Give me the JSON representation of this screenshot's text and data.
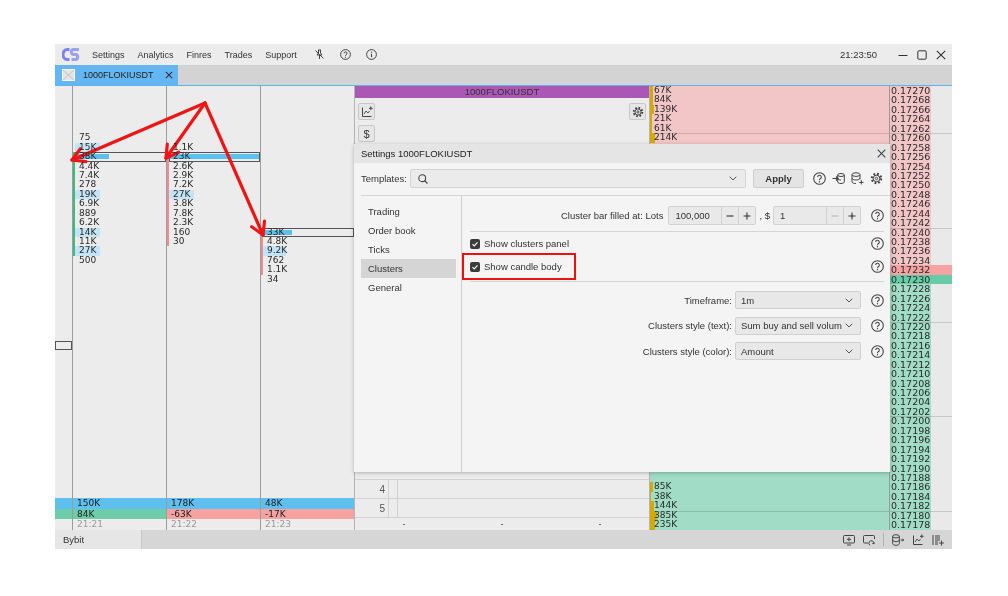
{
  "titlebar": {
    "menu": [
      "Settings",
      "Analytics",
      "Finres",
      "Trades",
      "Support"
    ],
    "clock": "21:23:50"
  },
  "tabs": [
    {
      "label": "1000FLOKIUSDT",
      "selected": true
    }
  ],
  "clusters": {
    "edge_column": {
      "delta": {
        "color": "#6dcca9"
      }
    },
    "columns": [
      {
        "candle": {
          "color": "#3dba80"
        },
        "volume": "150K",
        "delta": {
          "text": "84K",
          "color": "#6dcca9"
        },
        "time": "21:21",
        "cells_above": [
          {
            "text": "75",
            "kind": "plain"
          },
          {
            "text": "15K",
            "kind": "shaded",
            "level": 0.27
          }
        ],
        "body_cells": [
          {
            "text": "38K",
            "kind": "peak",
            "level": 0.37
          },
          {
            "text": "4.4K",
            "kind": "plain"
          },
          {
            "text": "7.4K",
            "kind": "plain"
          },
          {
            "text": "278",
            "kind": "plain"
          },
          {
            "text": "19K",
            "kind": "shaded",
            "level": 0.27
          },
          {
            "text": "6.9K",
            "kind": "plain"
          },
          {
            "text": "889",
            "kind": "plain"
          },
          {
            "text": "6.2K",
            "kind": "plain"
          },
          {
            "text": "14K",
            "kind": "shaded",
            "level": 0.27
          },
          {
            "text": "11K",
            "kind": "plain"
          },
          {
            "text": "27K",
            "kind": "shaded",
            "level": 0.27
          }
        ],
        "cells_below": [
          {
            "text": "500",
            "kind": "plain"
          }
        ]
      },
      {
        "candle": {
          "color": "#f28c8c"
        },
        "volume": "178K",
        "delta": {
          "text": "-63K",
          "color": "#f7a1a1"
        },
        "time": "21:22",
        "cells_above": [
          {
            "text": "1.1K",
            "kind": "plain"
          }
        ],
        "body_cells": [
          {
            "text": "23K",
            "kind": "peak",
            "level": 1
          },
          {
            "text": "2.6K",
            "kind": "plain"
          },
          {
            "text": "2.9K",
            "kind": "plain"
          },
          {
            "text": "7.2K",
            "kind": "plain"
          },
          {
            "text": "27K",
            "kind": "shaded",
            "level": 0.27
          },
          {
            "text": "3.8K",
            "kind": "plain"
          },
          {
            "text": "7.8K",
            "kind": "plain"
          },
          {
            "text": "2.3K",
            "kind": "plain"
          },
          {
            "text": "160",
            "kind": "plain"
          },
          {
            "text": "30",
            "kind": "plain"
          }
        ]
      },
      {
        "candle": {
          "color": "#f28c8c"
        },
        "volume": "48K",
        "delta": {
          "text": "-17K",
          "color": "#f7a1a1"
        },
        "time": "21:23",
        "body_cells": [
          {
            "text": "33K",
            "kind": "peak",
            "level": 0.31
          },
          {
            "text": "4.8K",
            "kind": "plain"
          },
          {
            "text": "9.2K",
            "kind": "shaded",
            "level": 0.25
          },
          {
            "text": "762",
            "kind": "plain"
          },
          {
            "text": "1.1K",
            "kind": "plain"
          }
        ],
        "cells_below": [
          {
            "text": "34",
            "kind": "plain"
          }
        ]
      }
    ]
  },
  "order_book": {
    "title": "1000FLOKIUSDT",
    "currency_button": "$",
    "row_numbers": [
      "4",
      "5"
    ],
    "footer": [
      "-",
      "-",
      "-"
    ],
    "asks": [
      {
        "text": "67K",
        "level": 0.012
      },
      {
        "text": "84K",
        "level": 0.012
      },
      {
        "text": "139K",
        "level": 0.018
      },
      {
        "text": "21K",
        "level": 0.008
      },
      {
        "text": "61K",
        "level": 0.01
      },
      {
        "text": "214K",
        "level": 0.022
      }
    ],
    "bids": [
      {
        "text": "85K",
        "level": 0.012
      },
      {
        "text": "38K",
        "level": 0.006
      },
      {
        "text": "144K",
        "level": 0.015
      },
      {
        "text": "385K",
        "level": 0.028
      },
      {
        "text": "235K",
        "level": 0.02
      }
    ],
    "prices": [
      {
        "text": "0.17270",
        "kind": "ask",
        "best": false
      },
      {
        "text": "0.17268",
        "kind": "ask",
        "best": false
      },
      {
        "text": "0.17266",
        "kind": "ask",
        "best": false
      },
      {
        "text": "0.17264",
        "kind": "ask",
        "best": false
      },
      {
        "text": "0.17262",
        "kind": "ask",
        "best": false
      },
      {
        "text": "0.17260",
        "kind": "ask",
        "best": false
      },
      {
        "text": "0.17258",
        "kind": "ask",
        "best": false
      },
      {
        "text": "0.17256",
        "kind": "ask",
        "best": false
      },
      {
        "text": "0.17254",
        "kind": "ask",
        "best": false
      },
      {
        "text": "0.17252",
        "kind": "ask",
        "best": false
      },
      {
        "text": "0.17250",
        "kind": "ask",
        "best": false
      },
      {
        "text": "0.17248",
        "kind": "ask",
        "best": false
      },
      {
        "text": "0.17246",
        "kind": "ask",
        "best": false
      },
      {
        "text": "0.17244",
        "kind": "ask",
        "best": false
      },
      {
        "text": "0.17242",
        "kind": "ask",
        "best": false
      },
      {
        "text": "0.17240",
        "kind": "ask",
        "best": false
      },
      {
        "text": "0.17238",
        "kind": "ask",
        "best": false
      },
      {
        "text": "0.17236",
        "kind": "ask",
        "best": false
      },
      {
        "text": "0.17234",
        "kind": "ask",
        "best": false
      },
      {
        "text": "0.17232",
        "kind": "ask",
        "best": true
      },
      {
        "text": "0.17230",
        "kind": "bid",
        "best": true
      },
      {
        "text": "0.17228",
        "kind": "bid",
        "best": false
      },
      {
        "text": "0.17226",
        "kind": "bid",
        "best": false
      },
      {
        "text": "0.17224",
        "kind": "bid",
        "best": false
      },
      {
        "text": "0.17222",
        "kind": "bid",
        "best": false
      },
      {
        "text": "0.17220",
        "kind": "bid",
        "best": false
      },
      {
        "text": "0.17218",
        "kind": "bid",
        "best": false
      },
      {
        "text": "0.17216",
        "kind": "bid",
        "best": false
      },
      {
        "text": "0.17214",
        "kind": "bid",
        "best": false
      },
      {
        "text": "0.17212",
        "kind": "bid",
        "best": false
      },
      {
        "text": "0.17210",
        "kind": "bid",
        "best": false
      },
      {
        "text": "0.17208",
        "kind": "bid",
        "best": false
      },
      {
        "text": "0.17206",
        "kind": "bid",
        "best": false
      },
      {
        "text": "0.17204",
        "kind": "bid",
        "best": false
      },
      {
        "text": "0.17202",
        "kind": "bid",
        "best": false
      },
      {
        "text": "0.17200",
        "kind": "bid",
        "best": false
      },
      {
        "text": "0.17198",
        "kind": "bid",
        "best": false
      },
      {
        "text": "0.17196",
        "kind": "bid",
        "best": false
      },
      {
        "text": "0.17194",
        "kind": "bid",
        "best": false
      },
      {
        "text": "0.17192",
        "kind": "bid",
        "best": false
      },
      {
        "text": "0.17190",
        "kind": "bid",
        "best": false
      },
      {
        "text": "0.17188",
        "kind": "bid",
        "best": false
      },
      {
        "text": "0.17186",
        "kind": "bid",
        "best": false
      },
      {
        "text": "0.17184",
        "kind": "bid",
        "best": false
      },
      {
        "text": "0.17182",
        "kind": "bid",
        "best": false
      },
      {
        "text": "0.17180",
        "kind": "bid",
        "best": false
      },
      {
        "text": "0.17178",
        "kind": "bid",
        "best": false
      }
    ]
  },
  "settings_dialog": {
    "title": "Settings 1000FLOKIUSDT",
    "templates_label": "Templates:",
    "apply": "Apply",
    "nav": [
      {
        "label": "Trading",
        "selected": false
      },
      {
        "label": "Order book",
        "selected": false
      },
      {
        "label": "Ticks",
        "selected": false
      },
      {
        "label": "Clusters",
        "selected": true
      },
      {
        "label": "General",
        "selected": false
      }
    ],
    "bar_fill": {
      "label": "Cluster bar filled at: Lots",
      "separator": ", $",
      "spinners": [
        {
          "value": "100,000",
          "minus_disabled": false
        },
        {
          "value": "1",
          "minus_disabled": true
        }
      ]
    },
    "checkboxes": [
      {
        "label": "Show clusters panel",
        "checked": true,
        "annotated": false
      },
      {
        "label": "Show candle body",
        "checked": true,
        "annotated": true
      }
    ],
    "selects": [
      {
        "label": "Timeframe:",
        "value": "1m"
      },
      {
        "label": "Clusters style (text):",
        "value": "Sum buy and sell volum"
      },
      {
        "label": "Clusters style (color):",
        "value": "Amount"
      }
    ]
  },
  "status_bar": {
    "exchange": "Bybit"
  }
}
